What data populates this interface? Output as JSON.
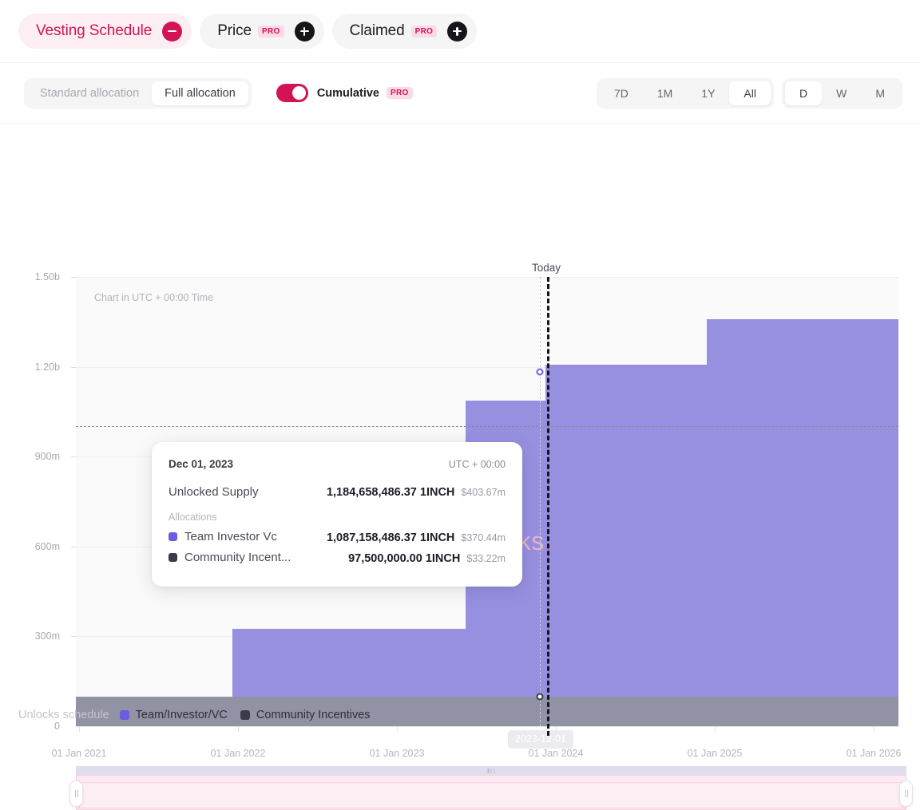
{
  "header": {
    "tabs": [
      {
        "label": "Vesting Schedule",
        "active": true,
        "pro": false,
        "action": "remove"
      },
      {
        "label": "Price",
        "active": false,
        "pro": true,
        "action": "add"
      },
      {
        "label": "Claimed",
        "active": false,
        "pro": true,
        "action": "add"
      }
    ],
    "pro_badge": "PRO"
  },
  "toolbar": {
    "allocation": {
      "options": [
        "Standard allocation",
        "Full allocation"
      ],
      "selected": "Full allocation"
    },
    "cumulative": {
      "label": "Cumulative",
      "pro_badge": "PRO",
      "enabled": true
    },
    "range": {
      "options": [
        "7D",
        "1M",
        "1Y",
        "All"
      ],
      "selected": "All"
    },
    "interval": {
      "options": [
        "D",
        "W",
        "M"
      ],
      "selected": "D"
    }
  },
  "chart": {
    "utc_note": "Chart in UTC + 00:00 Time",
    "today_label": "Today",
    "cursor_date": "2023-12-01",
    "watermark": "ocks",
    "watermark_dot": "."
  },
  "tooltip": {
    "date": "Dec 01, 2023",
    "utc": "UTC + 00:00",
    "total_label": "Unlocked Supply",
    "total_amount": "1,184,658,486.37 1INCH",
    "total_usd": "$403.67m",
    "allocations_label": "Allocations",
    "rows": [
      {
        "name": "Team Investor Vc",
        "amount": "1,087,158,486.37 1INCH",
        "usd": "$370.44m",
        "color": "#6c5ce0"
      },
      {
        "name": "Community Incent...",
        "amount": "97,500,000.00 1INCH",
        "usd": "$33.22m",
        "color": "#3b3b4a"
      }
    ]
  },
  "legend": {
    "title": "Unlocks schedule",
    "items": [
      {
        "label": "Team/Investor/VC",
        "color": "#6c5ce0"
      },
      {
        "label": "Community Incentives",
        "color": "#3b3b4a"
      }
    ]
  },
  "colors": {
    "accent": "#d31355",
    "team": "#9790e0",
    "community": "#9292a5",
    "pro_bg": "#fbd9e6"
  },
  "chart_data": {
    "type": "area",
    "title": "",
    "xlabel": "",
    "ylabel": "",
    "stacked": true,
    "step": true,
    "grid": true,
    "legend_position": "bottom-left",
    "ylim": [
      0,
      1500000000
    ],
    "ytick_labels": [
      "1.50b",
      "1.20b",
      "900m",
      "600m",
      "300m",
      "0"
    ],
    "ytick_values": [
      1500000000,
      1200000000,
      900000000,
      600000000,
      300000000,
      0
    ],
    "xtick_labels": [
      "01 Jan 2021",
      "01 Jan 2022",
      "01 Jan 2023",
      "01 Jan 2024",
      "01 Jan 2025",
      "01 Jan 2026"
    ],
    "x": [
      "2021-01-01",
      "2022-01-01",
      "2023-01-01",
      "2023-12-01",
      "2024-06-01",
      "2025-01-01",
      "2026-01-01"
    ],
    "annotations": [
      {
        "type": "vline",
        "label": "Today",
        "x": "2023-12-01",
        "style": "dashed",
        "color": "#15151a"
      },
      {
        "type": "hline",
        "value": 1000000000,
        "style": "dashed",
        "color": "#8a8a96"
      },
      {
        "type": "marker",
        "x": "2023-12-01",
        "value": 1184658486.37,
        "color": "#6c5ce0"
      },
      {
        "type": "marker",
        "x": "2023-12-01",
        "value": 97500000,
        "color": "#3b3b4a"
      }
    ],
    "series": [
      {
        "name": "Team/Investor/VC",
        "color": "#9790e0",
        "values": [
          0,
          195000000,
          887000000,
          1087158486.37,
          1190000000,
          1290000000,
          1390000000
        ]
      },
      {
        "name": "Community Incentives",
        "color": "#9292a5",
        "values": [
          97500000,
          97500000,
          97500000,
          97500000,
          97500000,
          97500000,
          97500000
        ]
      }
    ]
  }
}
